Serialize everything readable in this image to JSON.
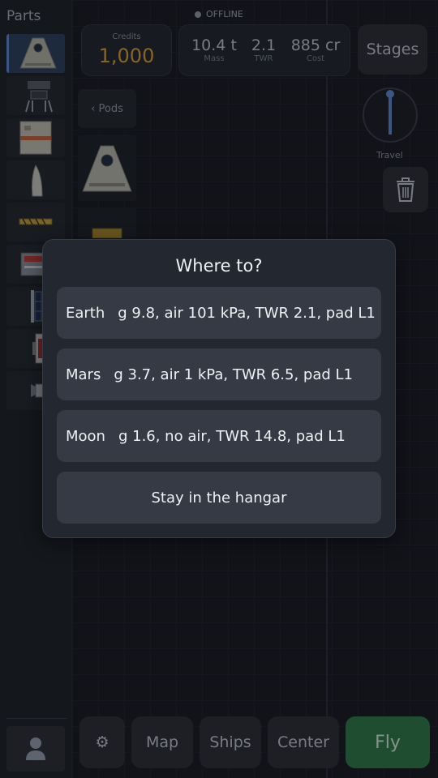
{
  "sidebar": {
    "title": "Parts"
  },
  "status": {
    "text": "OFFLINE"
  },
  "credits": {
    "label": "Credits",
    "value": "1,000"
  },
  "stats": [
    {
      "value": "10.4 t",
      "label": "Mass"
    },
    {
      "value": "2.1",
      "label": "TWR"
    },
    {
      "value": "885 cr",
      "label": "Cost"
    }
  ],
  "stages_label": "Stages",
  "pods_back_label": "‹ Pods",
  "travel_label": "Travel",
  "toolbar": {
    "settings_icon": "⚙",
    "map": "Map",
    "ships": "Ships",
    "center": "Center",
    "fly": "Fly"
  },
  "modal": {
    "title": "Where to?",
    "destinations": [
      {
        "name": "Earth",
        "info": "g 9.8, air 101 kPa, TWR 2.1, pad L1"
      },
      {
        "name": "Mars",
        "info": "g 3.7, air 1 kPa, TWR 6.5, pad L1"
      },
      {
        "name": "Moon",
        "info": "g 1.6, no air, TWR 14.8, pad L1"
      }
    ],
    "stay_label": "Stay in the hangar"
  },
  "colors": {
    "accent_credits": "#e2a63c",
    "fly_button": "#2f7d45",
    "selected_slot": "#5d8dd8"
  },
  "icons": {
    "profile": "person-icon",
    "trash": "trash-icon",
    "settings": "gear-icon",
    "travel": "compass-dial-icon"
  }
}
